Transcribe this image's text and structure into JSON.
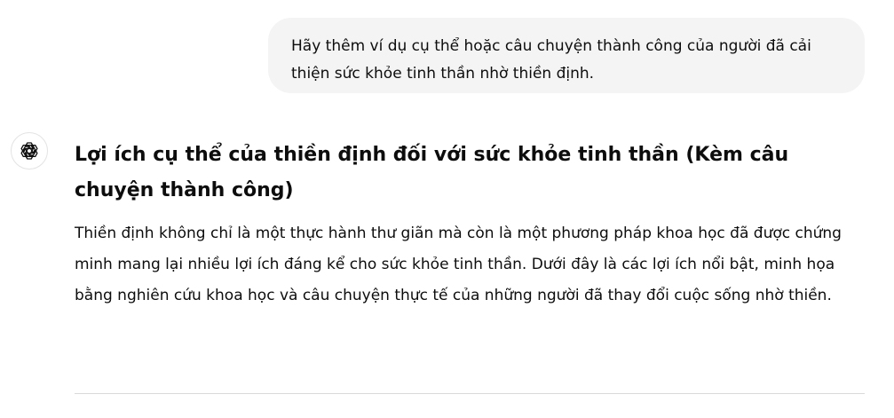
{
  "user_message": {
    "text": "Hãy thêm ví dụ cụ thể hoặc câu chuyện thành công của người đã cải thiện sức khỏe tinh thần nhờ thiền định."
  },
  "assistant": {
    "avatar_icon": "openai-logo-icon",
    "heading": "Lợi ích cụ thể của thiền định đối với sức khỏe tinh thần (Kèm câu chuyện thành công)",
    "paragraph": "Thiền định không chỉ là một thực hành thư giãn mà còn là một phương pháp khoa học đã được chứng minh mang lại nhiều lợi ích đáng kể cho sức khỏe tinh thần. Dưới đây là các lợi ích nổi bật, minh họa bằng nghiên cứu khoa học và câu chuyện thực tế của những người đã thay đổi cuộc sống nhờ thiền."
  },
  "colors": {
    "bubble_bg": "#f4f4f4",
    "text": "#0d0d0d",
    "divider": "#d9d9d9"
  }
}
